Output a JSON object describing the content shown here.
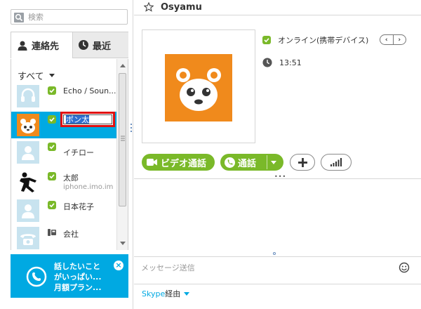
{
  "search": {
    "placeholder": "検索"
  },
  "tabs": [
    {
      "label": "連絡先"
    },
    {
      "label": "最近"
    }
  ],
  "filter": {
    "label": "すべて"
  },
  "contacts": [
    {
      "name": "Echo / Soun...",
      "sub": "",
      "avatar": "headset-icon",
      "status": "online"
    },
    {
      "name": "ポン太",
      "sub": "",
      "avatar": "bear-icon",
      "status": "online",
      "selected": true,
      "editing": true
    },
    {
      "name": "イチロー",
      "sub": "",
      "avatar": "person-icon",
      "status": "online"
    },
    {
      "name": "太郎",
      "sub": "iphone.imo.im",
      "avatar": "dancer-icon",
      "status": "online"
    },
    {
      "name": "日本花子",
      "sub": "",
      "avatar": "person-icon",
      "status": "online"
    },
    {
      "name": "会社",
      "sub": "",
      "avatar": "phone-icon",
      "status": "landline"
    }
  ],
  "promo": {
    "line1": "話したいこと",
    "line2": "がいっぱい...",
    "line3": "月額プラン..."
  },
  "header": {
    "title": "Osyamu"
  },
  "profile": {
    "status_text": "オンライン(携帯デバイス)",
    "time": "13:51"
  },
  "actions": {
    "video_label": "ビデオ通話",
    "call_label": "通話"
  },
  "compose": {
    "placeholder": "メッセージ送信"
  },
  "via": {
    "skype": "Skype",
    "rest": "経由"
  },
  "colors": {
    "accent": "#00a9e2",
    "green": "#7ab929",
    "orange": "#f08a1c",
    "highlight_red": "#e01010"
  }
}
